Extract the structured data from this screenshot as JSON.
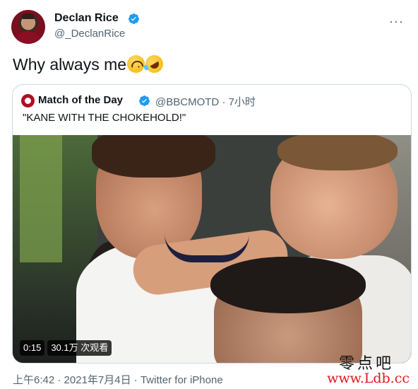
{
  "author": {
    "display_name": "Declan Rice",
    "handle": "@_DeclanRice",
    "avatar_icon": "avatar-photo",
    "verified_color": "#1d9bf0"
  },
  "tweet": {
    "text": "Why always me",
    "emojis": [
      "upside-down-face-emoji",
      "rolling-on-floor-laughing-emoji"
    ]
  },
  "quoted": {
    "display_name": "Match of the Day",
    "handle": "@BBCMOTD",
    "separator": "·",
    "time": "7小时",
    "text": "\"KANE WITH THE CHOKEHOLD!\"",
    "video": {
      "duration": "0:15",
      "views": "30.1万 次观看"
    }
  },
  "footer": {
    "time": "上午6:42",
    "separator1": " · ",
    "date": "2021年7月4日",
    "separator2": " · ",
    "source": "Twitter for iPhone"
  },
  "watermark": {
    "top": "零点吧",
    "bottom": "www.Ldb.cc"
  },
  "colors": {
    "text": "#0f1419",
    "secondary": "#536471",
    "border": "#cfd9de",
    "accent": "#1d9bf0"
  }
}
